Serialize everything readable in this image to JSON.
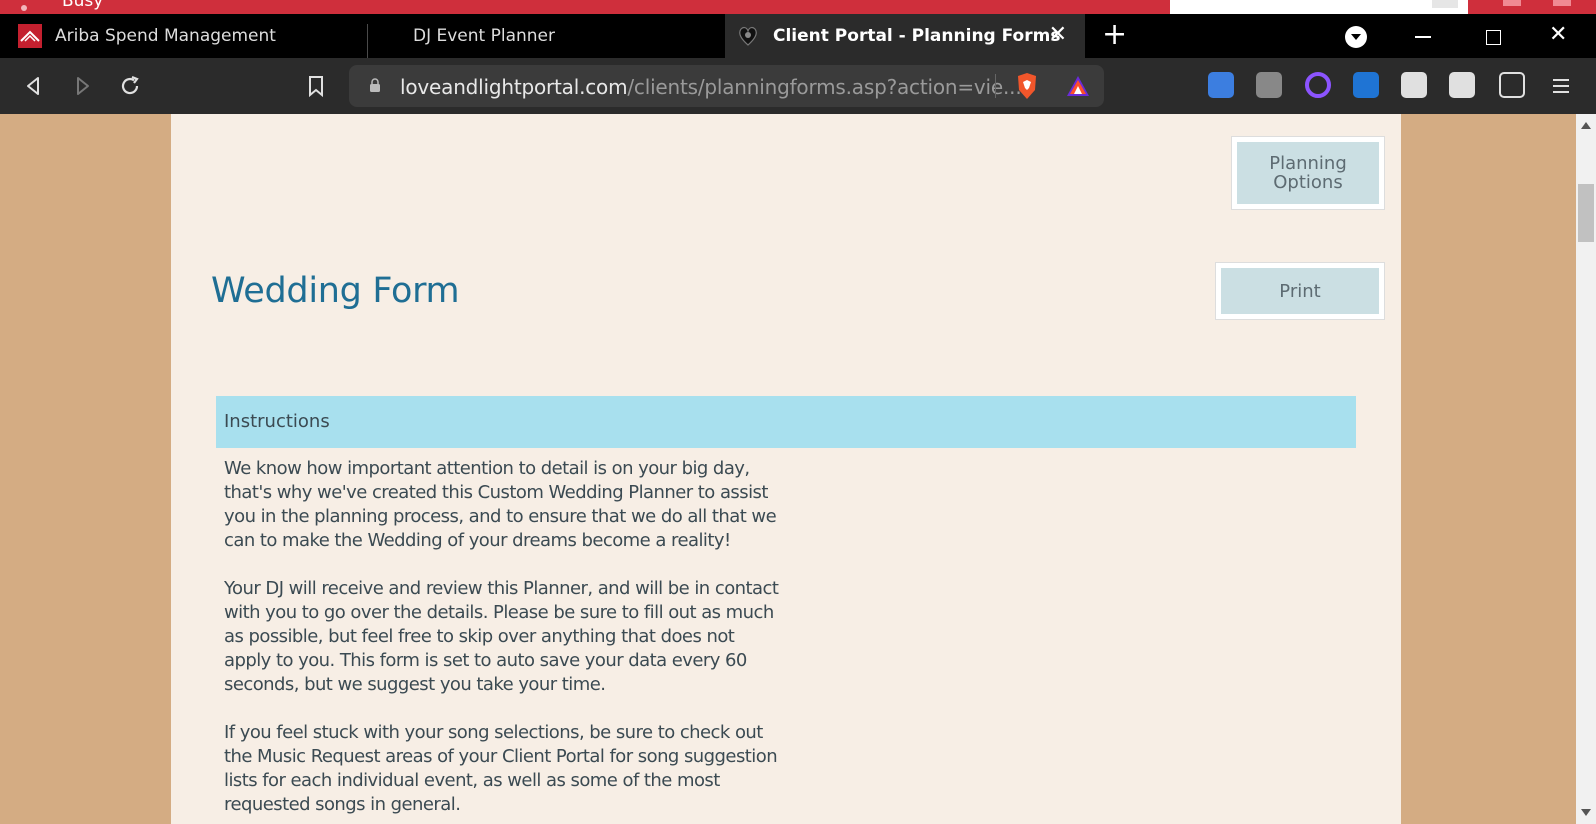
{
  "os_bar": {
    "status_text": "Busy"
  },
  "tabs": [
    {
      "label": "Ariba Spend Management"
    },
    {
      "label": "DJ Event Planner"
    },
    {
      "label": "Client Portal - Planning Forms",
      "active": true
    }
  ],
  "tab_controls": {
    "close_glyph": "✕",
    "new_tab_glyph": "+",
    "close_window_glyph": "✕"
  },
  "address_bar": {
    "domain": "loveandlightportal.com",
    "path": "/clients/planningforms.asp?action=vie..."
  },
  "extensions": [
    "translate-icon",
    "copies-icon",
    "circle-extension-icon",
    "p-extension-icon",
    "upload-extension-icon",
    "puzzle-icon",
    "wallet-icon",
    "menu-icon"
  ],
  "page": {
    "planning_options_button": "Planning Options",
    "print_button": "Print",
    "title": "Wedding Form",
    "instructions_header": "Instructions",
    "paragraphs": [
      "We know how important attention to detail is on your big day, that's why we've created this Custom Wedding Planner to assist you in the planning process, and to ensure that we do all that we can to make the Wedding of your dreams become a reality!",
      "Your DJ will receive and review this Planner, and will be in contact with you to go over the details. Please be sure to fill out as much as possible, but feel free to skip over anything that does not apply to you. This form is set to auto save your data every 60 seconds, but we suggest you take your time.",
      "If you feel stuck with your song selections, be sure to check out the Music Request areas of your Client Portal for song suggestion lists for each individual event, as well as some of the most requested songs in general."
    ]
  },
  "colors": {
    "title_blue": "#1f6e94",
    "instructions_bar": "#a8e0ee",
    "page_background": "#f7eee5",
    "outer_background": "#d4ac83"
  }
}
